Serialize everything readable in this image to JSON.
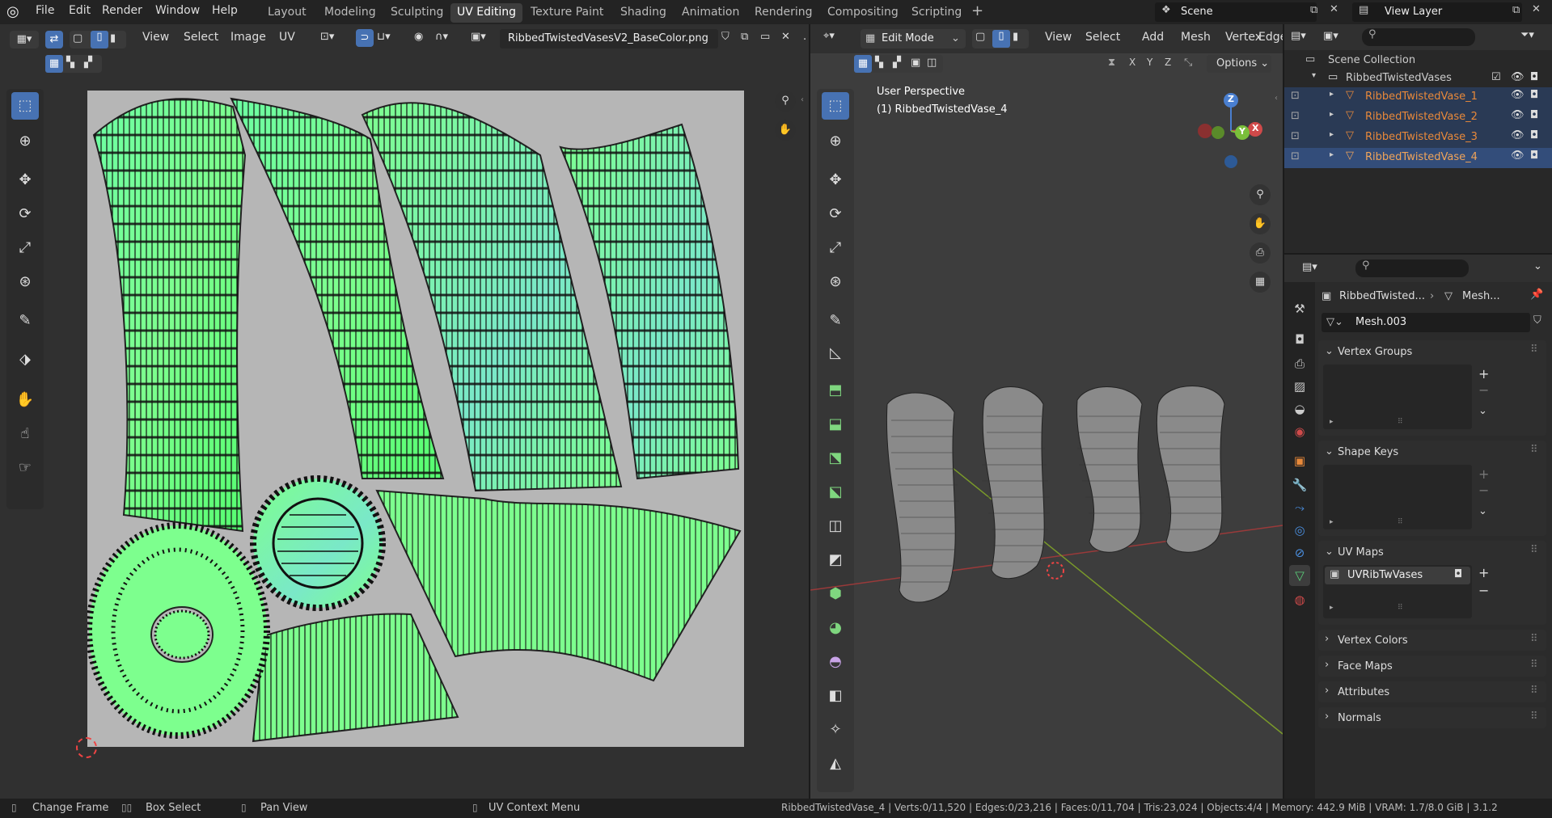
{
  "topbar": {
    "menus": [
      "File",
      "Edit",
      "Render",
      "Window",
      "Help"
    ],
    "workspaces": [
      "Layout",
      "Modeling",
      "Sculpting",
      "UV Editing",
      "Texture Paint",
      "Shading",
      "Animation",
      "Rendering",
      "Compositing",
      "Scripting"
    ],
    "add_workspace": "+",
    "scene_label": "Scene",
    "view_layer_label": "View Layer"
  },
  "uv_editor": {
    "menus": [
      "View",
      "Select",
      "Image",
      "UV"
    ],
    "image_name": "RibbedTwistedVasesV2_BaseColor.png"
  },
  "viewport": {
    "mode": "Edit Mode",
    "menus": [
      "View",
      "Select",
      "Add",
      "Mesh",
      "Vertex",
      "Edge"
    ],
    "axes": [
      "X",
      "Y",
      "Z"
    ],
    "options_label": "Options",
    "perspective_label": "User Perspective",
    "object_label": "(1) RibbedTwistedVase_4",
    "gizmo": {
      "x": "X",
      "y": "Y",
      "z": "Z"
    }
  },
  "outliner": {
    "root": "Scene Collection",
    "collection": "RibbedTwistedVases",
    "objects": [
      "RibbedTwistedVase_1",
      "RibbedTwistedVase_2",
      "RibbedTwistedVase_3",
      "RibbedTwistedVase_4"
    ]
  },
  "properties": {
    "breadcrumb_object": "RibbedTwisted...",
    "breadcrumb_data": "Mesh...",
    "mesh_name": "Mesh.003",
    "sections": {
      "vertex_groups": "Vertex Groups",
      "shape_keys": "Shape Keys",
      "uv_maps": "UV Maps",
      "vertex_colors": "Vertex Colors",
      "face_maps": "Face Maps",
      "attributes": "Attributes",
      "normals": "Normals"
    },
    "uv_map_item": "UVRibTwVases"
  },
  "statusbar": {
    "hints": [
      "Change Frame",
      "Box Select",
      "Pan View",
      "UV Context Menu"
    ],
    "stats": "RibbedTwistedVase_4 | Verts:0/11,520 | Edges:0/23,216 | Faces:0/11,704 | Tris:23,024 | Objects:4/4 | Memory: 442.9 MiB | VRAM: 1.7/8.0 GiB | 3.1.2"
  },
  "colors": {
    "accent": "#4772b3",
    "uv_fill": "#7dff8e",
    "object_orange": "#e8893a"
  },
  "icons": [
    "blender-logo-icon",
    "zoom-icon",
    "hand-icon",
    "camera-icon",
    "grid-icon",
    "eye-icon",
    "camera-render-icon",
    "checkbox-icon"
  ]
}
